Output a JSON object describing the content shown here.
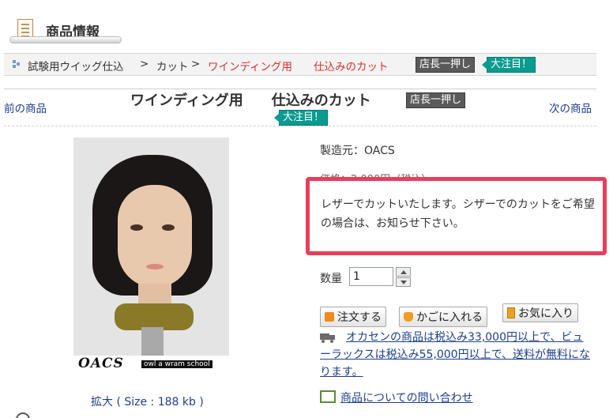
{
  "section": {
    "title": "商品情報"
  },
  "breadcrumb": {
    "parts": [
      "試験用ウイッグ仕込",
      " > ",
      "カット",
      " > "
    ],
    "current": "ワインディング用　　仕込みのカット",
    "badges": [
      "店長一押し",
      "大注目！"
    ]
  },
  "nav": {
    "prev": "前の商品",
    "next": "次の商品"
  },
  "product": {
    "title": "ワインディング用　　仕込みのカット",
    "badges": [
      "店長一押し",
      "大注目！"
    ],
    "image_logo": "OACS",
    "image_logo_sub": "owl a wram school",
    "enlarge": "拡大 ( Size : 188 kb )",
    "maker": "製造元：OACS",
    "price_partial": "価格：2,000円（税込）",
    "note": "レザーでカットいたします。シザーでのカットをご希望の場合は、お知らせ下さい。",
    "qty_label": "数量",
    "qty_value": "1"
  },
  "buttons": {
    "order": "注文する",
    "cart": "かごに入れる",
    "fav": "お気に入り"
  },
  "shipping": "オカセンの商品は税込み33,000円以上で、ビューラックスは税込み55,000円以上で、送料が無料になります。",
  "contact": "商品についての問い合わせ",
  "colors": {
    "highlight_border": "#ea3d5a",
    "badge_gray": "#5a5a5a",
    "badge_teal": "#0a9b8f",
    "link": "#1d3f8a",
    "red": "#d9312f"
  }
}
